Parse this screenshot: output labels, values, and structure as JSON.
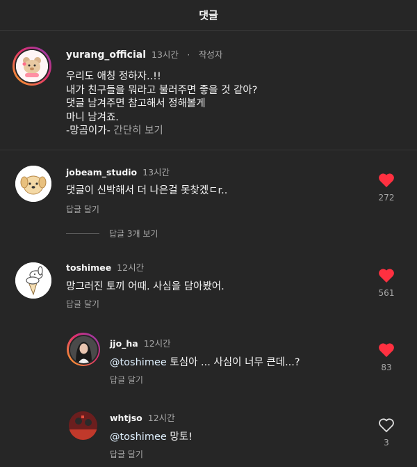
{
  "header": {
    "title": "댓글"
  },
  "caption": {
    "username": "yurang_official",
    "time": "13시간",
    "separator": "·",
    "author_tag": "작성자",
    "lines": [
      "우리도 애칭 정하자..!!",
      "내가 친구들을 뭐라고 불러주면 좋을 것 같아?",
      "댓글 남겨주면 참고해서 정해볼게",
      "마니 남겨죠.",
      "-망곰이가-"
    ],
    "more": " 간단히 보기"
  },
  "comments": [
    {
      "username": "jobeam_studio",
      "time": "13시간",
      "text": "댓글이 신박해서 더 나은걸 못찾겠ㄷr..",
      "reply": "답글 달기",
      "likes": "272",
      "liked": true
    },
    {
      "username": "toshimee",
      "time": "12시간",
      "text": "망그러진 토끼 어때. 사심을 담아봤어.",
      "reply": "답글 달기",
      "likes": "561",
      "liked": true
    },
    {
      "username": "jjo_ha",
      "time": "12시간",
      "mention": "@toshimee",
      "text": " 토심아 ... 사심이 너무 큰데...?",
      "reply": "답글 달기",
      "likes": "83",
      "liked": true
    },
    {
      "username": "whtjso",
      "time": "12시간",
      "mention": "@toshimee",
      "text": " 망토!",
      "reply": "답글 달기",
      "likes": "3",
      "liked": false
    }
  ],
  "view_replies": "답글 3개 보기",
  "colors": {
    "background": "#262626",
    "heart": "#ff3040",
    "secondary_text": "#a8a8a8"
  },
  "icons": [
    "heart-filled-icon",
    "heart-outline-icon"
  ]
}
